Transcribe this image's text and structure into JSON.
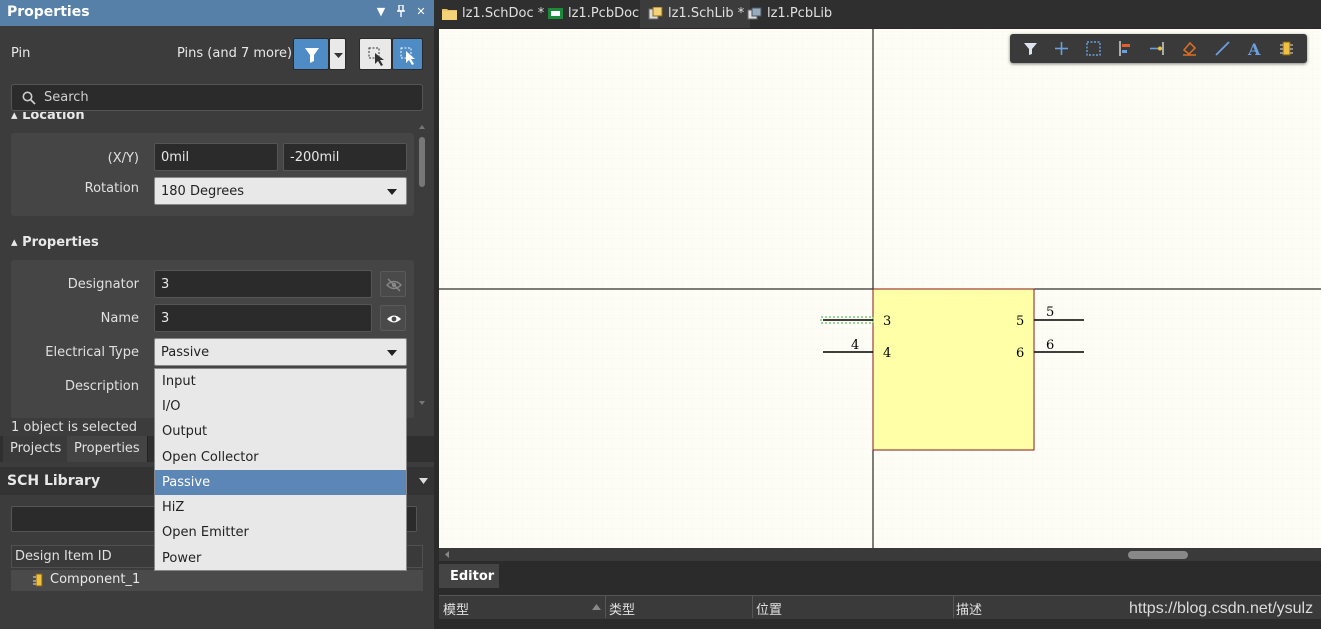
{
  "properties_panel": {
    "title": "Properties",
    "object_kind": "Pin",
    "filter_summary": "Pins (and 7 more)",
    "search_placeholder": "Search",
    "location": {
      "header": "Location",
      "xy_label": "(X/Y)",
      "x_value": "0mil",
      "y_value": "-200mil",
      "rotation_label": "Rotation",
      "rotation_value": "180 Degrees"
    },
    "properties": {
      "header": "Properties",
      "designator_label": "Designator",
      "designator_value": "3",
      "name_label": "Name",
      "name_value": "3",
      "electrical_type_label": "Electrical Type",
      "electrical_type_value": "Passive",
      "description_label": "Description"
    },
    "selection_info": "1 object is selected",
    "tabs": [
      "Projects",
      "Properties"
    ]
  },
  "electrical_type_dropdown": {
    "options": [
      "Input",
      "I/O",
      "Output",
      "Open Collector",
      "Passive",
      "HiZ",
      "Open Emitter",
      "Power"
    ],
    "selected": "Passive"
  },
  "sch_library": {
    "title": "SCH Library",
    "column_header": "Design Item ID",
    "items": [
      "Component_1"
    ]
  },
  "document_tabs": [
    {
      "label": "lz1.SchDoc *",
      "icon": "schdoc-icon"
    },
    {
      "label": "lz1.PcbDoc",
      "icon": "pcbdoc-icon"
    },
    {
      "label": "lz1.SchLib *",
      "icon": "schlib-icon",
      "active": true
    },
    {
      "label": "lz1.PcbLib",
      "icon": "pcblib-icon"
    }
  ],
  "component": {
    "pins_left": [
      {
        "outer": "",
        "inner": "3"
      },
      {
        "outer": "4",
        "inner": "4"
      }
    ],
    "pins_right": [
      {
        "outer": "5",
        "inner": "5"
      },
      {
        "outer": "6",
        "inner": "6"
      }
    ],
    "body_color": "#ffffa8",
    "border_color": "#8b1a1a"
  },
  "toolbar_icons": [
    "filter-icon",
    "add-icon",
    "select-rect-icon",
    "align-icon",
    "place-pin-icon",
    "eraser-icon",
    "line-icon",
    "text-icon",
    "component-icon"
  ],
  "editor": {
    "tab": "Editor",
    "columns": [
      "模型",
      "类型",
      "位置",
      "描述"
    ]
  },
  "watermark": "https://blog.csdn.net/ysulz",
  "colors": {
    "accent": "#5680a8",
    "panel_bg": "#3c3c3c",
    "selected_item": "#5b86b5",
    "canvas_bg": "#fdfdf6"
  }
}
